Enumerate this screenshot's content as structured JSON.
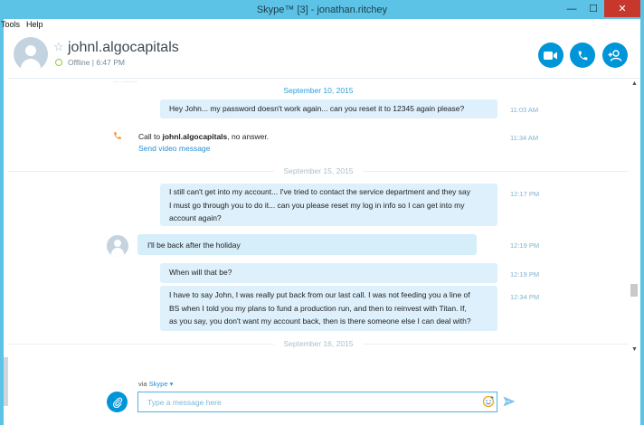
{
  "window": {
    "title": "Skype™ [3] - jonathan.ritchey",
    "min_glyph": "—",
    "max_glyph": "☐",
    "close_glyph": "✕"
  },
  "menu": [
    "Tools",
    "Help"
  ],
  "header": {
    "contact_name": "johnl.algocapitals",
    "status": "Offline | 6:47 PM",
    "status_color": "#9ec33a",
    "favorite_icon": "star-outline-icon",
    "actions": [
      "video-call-icon",
      "call-icon",
      "add-contact-icon"
    ],
    "accent": "#0095d9"
  },
  "conversation": {
    "faded_top": "... ........",
    "groups": [
      {
        "date": "September 10, 2015",
        "messages": [
          {
            "direction": "out",
            "text": "Hey John... my password doesn't work again... can you reset it to 12345 again please?",
            "time": "11:03 AM"
          }
        ],
        "call": {
          "prefix": "Call to ",
          "contact": "johnl.algocapitals",
          "suffix": ", no answer.",
          "time": "11:34 AM",
          "link": "Send video message",
          "icon": "phone-missed-icon",
          "icon_color": "#f28a1f"
        }
      },
      {
        "date": "September 15, 2015",
        "messages": [
          {
            "direction": "out",
            "lines": [
              "I still can't get into my account... I've tried to contact the service department and they say",
              "I must go through you to do it... can you please reset my log in info so I can get into my",
              "account again?"
            ],
            "time": "12:17 PM"
          },
          {
            "direction": "in",
            "text": "I'll be back after the holiday",
            "time": "12:19 PM"
          },
          {
            "direction": "out",
            "text": "When will that be?",
            "time": "12:19 PM"
          },
          {
            "direction": "out",
            "lines": [
              "I have to say John, I was really put back from our last call.  I was not feeding you a line of",
              "BS when I told you my plans to fund a production run, and then to reinvest with Titan.  If,",
              "as you say, you don't want my account back, then is there someone else I can deal with?"
            ],
            "time": "12:34 PM"
          }
        ]
      },
      {
        "date": "September 16, 2015",
        "messages": []
      }
    ]
  },
  "compose": {
    "via_prefix": "via ",
    "via_link": "Skype ▾",
    "placeholder": "Type a message here",
    "value": ""
  }
}
